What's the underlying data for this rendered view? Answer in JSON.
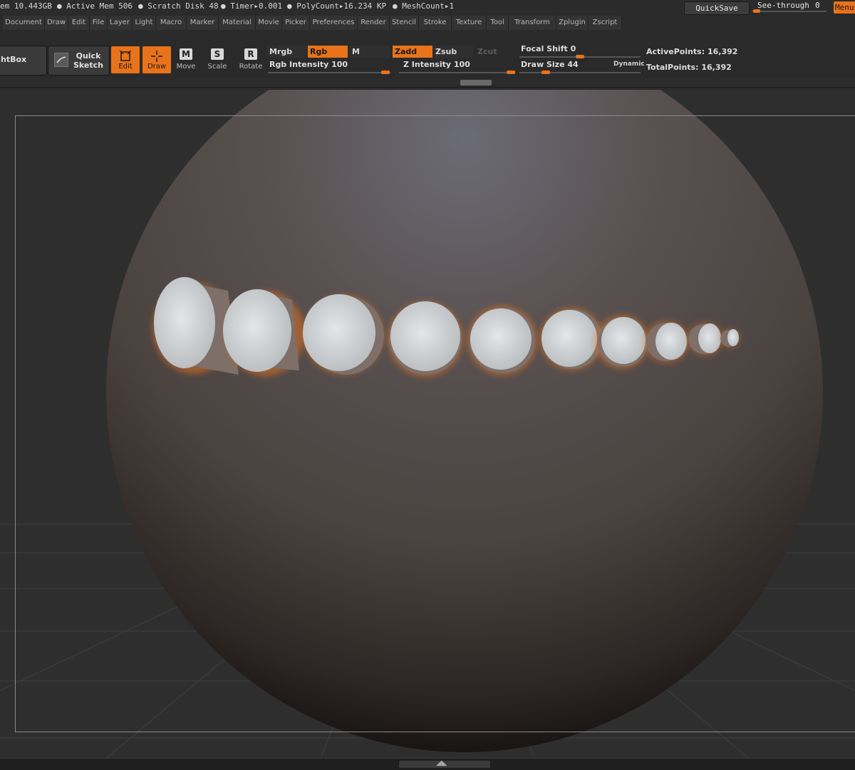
{
  "status": {
    "mem": "em 10.443GB",
    "active_mem": "● Active Mem 506",
    "scratch_disk": "● Scratch Disk 48",
    "timer": "● Timer▸0.001",
    "polycount": "● PolyCount▸16.234 KP",
    "meshcount": "● MeshCount▸1",
    "quicksave": "QuickSave",
    "see_through_label": "See-through",
    "see_through_value": "0",
    "see_through_level": 0.0,
    "menus": "Menus"
  },
  "menu": {
    "items": [
      "Document",
      "Draw",
      "Edit",
      "File",
      "Layer",
      "Light",
      "Macro",
      "Marker",
      "Material",
      "Movie",
      "Picker",
      "Preferences",
      "Render",
      "Stencil",
      "Stroke",
      "Texture",
      "Tool",
      "Transform",
      "Zplugin",
      "Zscript"
    ]
  },
  "toolbar": {
    "lightbox": "htBox",
    "quick_sketch_line1": "Quick",
    "quick_sketch_line2": "Sketch",
    "edit": "Edit",
    "draw": "Draw",
    "move": "Move",
    "scale": "Scale",
    "rotate": "Rotate",
    "move_glyph": "M",
    "scale_glyph": "S",
    "rotate_glyph": "R",
    "mrgb": "Mrgb",
    "rgb": "Rgb",
    "m": "M",
    "zadd": "Zadd",
    "zsub": "Zsub",
    "zcut": "Zcut",
    "rgb_intensity_label": "Rgb Intensity",
    "rgb_intensity_value": "100",
    "z_intensity_label": "Z Intensity",
    "z_intensity_value": "100",
    "focal_shift_label": "Focal Shift",
    "focal_shift_value": "0",
    "draw_size_label": "Draw Size",
    "draw_size_value": "44",
    "dynamic": "Dynamic",
    "active_points_label": "ActivePoints:",
    "active_points_value": "16,392",
    "total_points_label": "TotalPoints:",
    "total_points_value": "16,392"
  },
  "colors": {
    "accent": "#e8731a",
    "panel": "#2b2b2b",
    "sphere": "#58504c"
  },
  "icons": {
    "edit": "edit-frame-icon",
    "draw": "draw-crosshair-icon",
    "quick_sketch": "quick-sketch-icon",
    "expand": "expand-arrows-icon"
  }
}
